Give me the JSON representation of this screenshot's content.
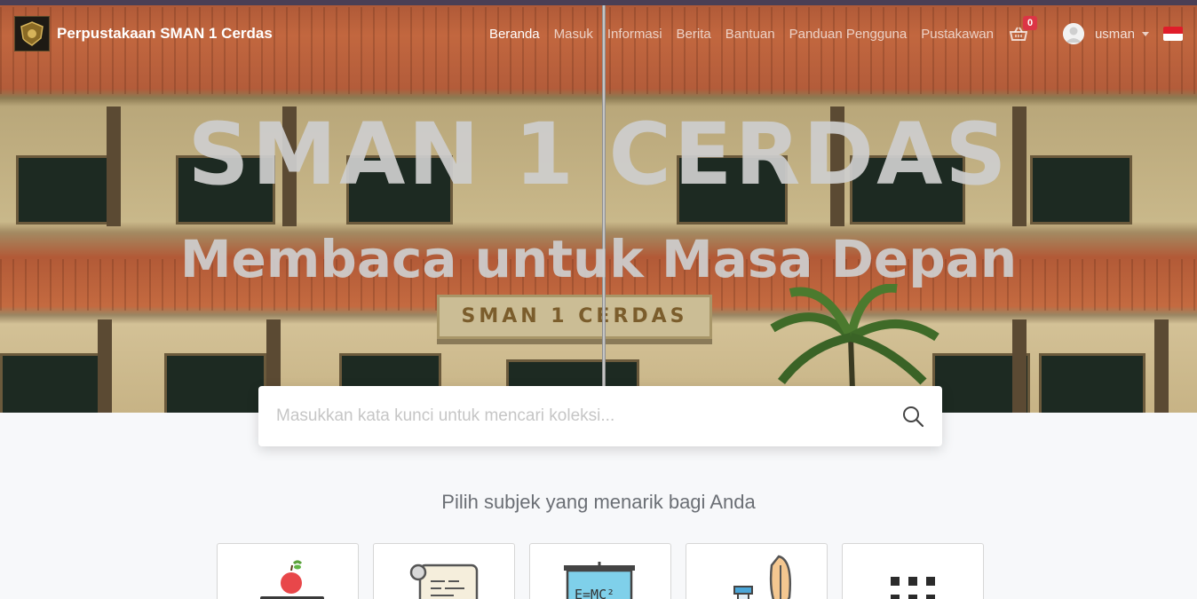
{
  "navbar": {
    "brand": "Perpustakaan SMAN 1 Cerdas",
    "links": [
      "Beranda",
      "Masuk",
      "Informasi",
      "Berita",
      "Bantuan",
      "Panduan Pengguna",
      "Pustakawan"
    ],
    "cart_count": "0",
    "username": "usman"
  },
  "hero": {
    "title": "SMAN 1 CERDAS",
    "subtitle": "Membaca untuk Masa Depan",
    "sign_text": "SMAN 1 CERDAS"
  },
  "search": {
    "placeholder": "Masukkan kata kunci untuk mencari koleksi..."
  },
  "subjects": {
    "heading": "Pilih subjek yang menarik bagi Anda",
    "cards": [
      {
        "icon": "apple-books-icon"
      },
      {
        "icon": "scroll-icon"
      },
      {
        "icon": "blackboard-formula-icon",
        "text": "E=MC²"
      },
      {
        "icon": "quill-ink-icon"
      },
      {
        "icon": "grid-more-icon"
      }
    ]
  },
  "colors": {
    "badge": "#dc3545",
    "hero_text": "#cdcdcd",
    "page_bg": "#f7f8fa"
  }
}
